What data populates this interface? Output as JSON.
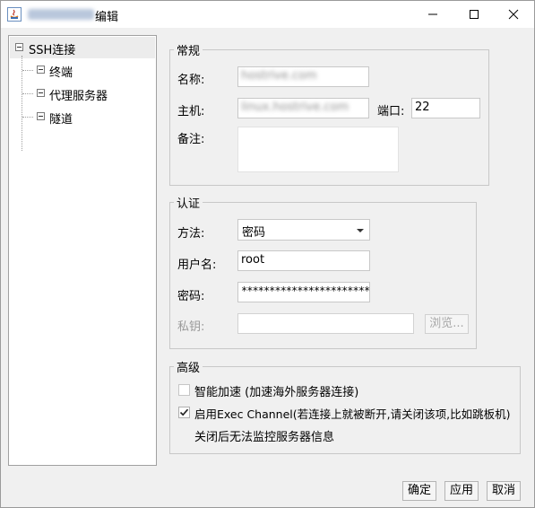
{
  "window": {
    "title_suffix": "编辑",
    "minimize_glyph": "—",
    "maximize_glyph": "☐",
    "close_glyph": "✕"
  },
  "tree": {
    "root": "SSH连接",
    "items": [
      "终端",
      "代理服务器",
      "隧道"
    ]
  },
  "general": {
    "legend": "常规",
    "name_label": "名称:",
    "name_value": "hostrive.com",
    "host_label": "主机:",
    "host_value": "linux.hostrive.com",
    "port_label": "端口:",
    "port_value": "22",
    "notes_label": "备注:"
  },
  "auth": {
    "legend": "认证",
    "method_label": "方法:",
    "method_value": "密码",
    "user_label": "用户名:",
    "user_value": "root",
    "password_label": "密码:",
    "password_value": "************************",
    "key_label": "私钥:",
    "browse_label": "浏览..."
  },
  "advanced": {
    "legend": "高级",
    "accel_label": "智能加速 (加速海外服务器连接)",
    "accel_checked": false,
    "exec_label": "启用Exec Channel(若连接上就被断开,请关闭该项,比如跳板机)",
    "exec_checked": true,
    "exec_note": "关闭后无法监控服务器信息"
  },
  "footer": {
    "ok_label": "确定",
    "apply_label": "应用",
    "cancel_label": "取消"
  }
}
